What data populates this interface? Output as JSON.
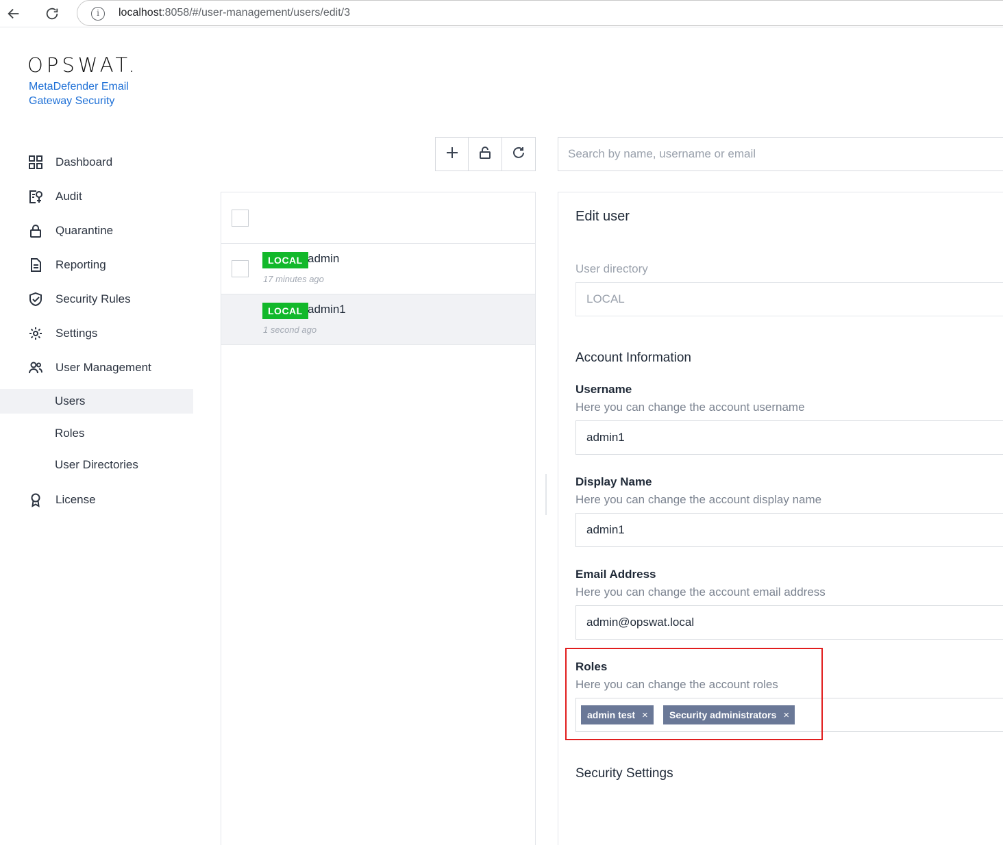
{
  "browser": {
    "url_host": "localhost",
    "url_rest": ":8058/#/user-management/users/edit/3",
    "info_glyph": "i"
  },
  "logo": {
    "wordmark": "OPSWAT.",
    "subtitle_line1": "MetaDefender Email",
    "subtitle_line2": "Gateway Security"
  },
  "sidebar": {
    "items": [
      {
        "label": "Dashboard",
        "icon": "dashboard-grid-icon"
      },
      {
        "label": "Audit",
        "icon": "audit-icon"
      },
      {
        "label": "Quarantine",
        "icon": "lock-icon"
      },
      {
        "label": "Reporting",
        "icon": "report-document-icon"
      },
      {
        "label": "Security Rules",
        "icon": "shield-check-icon"
      },
      {
        "label": "Settings",
        "icon": "gear-icon"
      },
      {
        "label": "User Management",
        "icon": "users-icon"
      }
    ],
    "sub_items": [
      {
        "label": "Users",
        "active": true
      },
      {
        "label": "Roles",
        "active": false
      },
      {
        "label": "User Directories",
        "active": false
      }
    ],
    "license": {
      "label": "License",
      "icon": "award-ribbon-icon"
    }
  },
  "toolbar": {
    "add": "plus-icon",
    "unlock": "unlock-icon",
    "refresh": "refresh-icon"
  },
  "search": {
    "placeholder": "Search by name, username or email",
    "value": ""
  },
  "user_list": {
    "rows": [
      {
        "source": "LOCAL",
        "name": "admin",
        "time": "17 minutes ago",
        "selected": false
      },
      {
        "source": "LOCAL",
        "name": "admin1",
        "time": "1 second ago",
        "selected": true
      }
    ]
  },
  "edit": {
    "title": "Edit user",
    "user_directory_label": "User directory",
    "user_directory_value": "LOCAL",
    "account_info_title": "Account Information",
    "username": {
      "label": "Username",
      "help": "Here you can change the account username",
      "value": "admin1"
    },
    "display_name": {
      "label": "Display Name",
      "help": "Here you can change the account display name",
      "value": "admin1"
    },
    "email": {
      "label": "Email Address",
      "help": "Here you can change the account email address",
      "value": "admin@opswat.local"
    },
    "roles": {
      "label": "Roles",
      "help": "Here you can change the account roles",
      "chips": [
        {
          "label": "admin test",
          "remove": "×"
        },
        {
          "label": "Security administrators",
          "remove": "×"
        }
      ]
    },
    "security_title": "Security Settings"
  },
  "colors": {
    "accent_blue": "#1d6fd6",
    "badge_green": "#12b82a",
    "chip_slate": "#6a7897",
    "highlight_red": "#e11d1d"
  }
}
